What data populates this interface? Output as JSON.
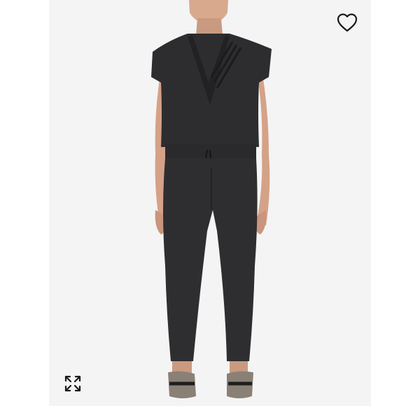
{
  "viewer": {
    "image_subject": "product-photo",
    "icons": {
      "like": "heart-outline-icon",
      "expand": "expand-arrows-icon"
    },
    "colors": {
      "background": "#ffffff",
      "photo_background": "#f4f4f4",
      "garment": "#2c2c2f",
      "icon": "#1a1a1a"
    }
  }
}
